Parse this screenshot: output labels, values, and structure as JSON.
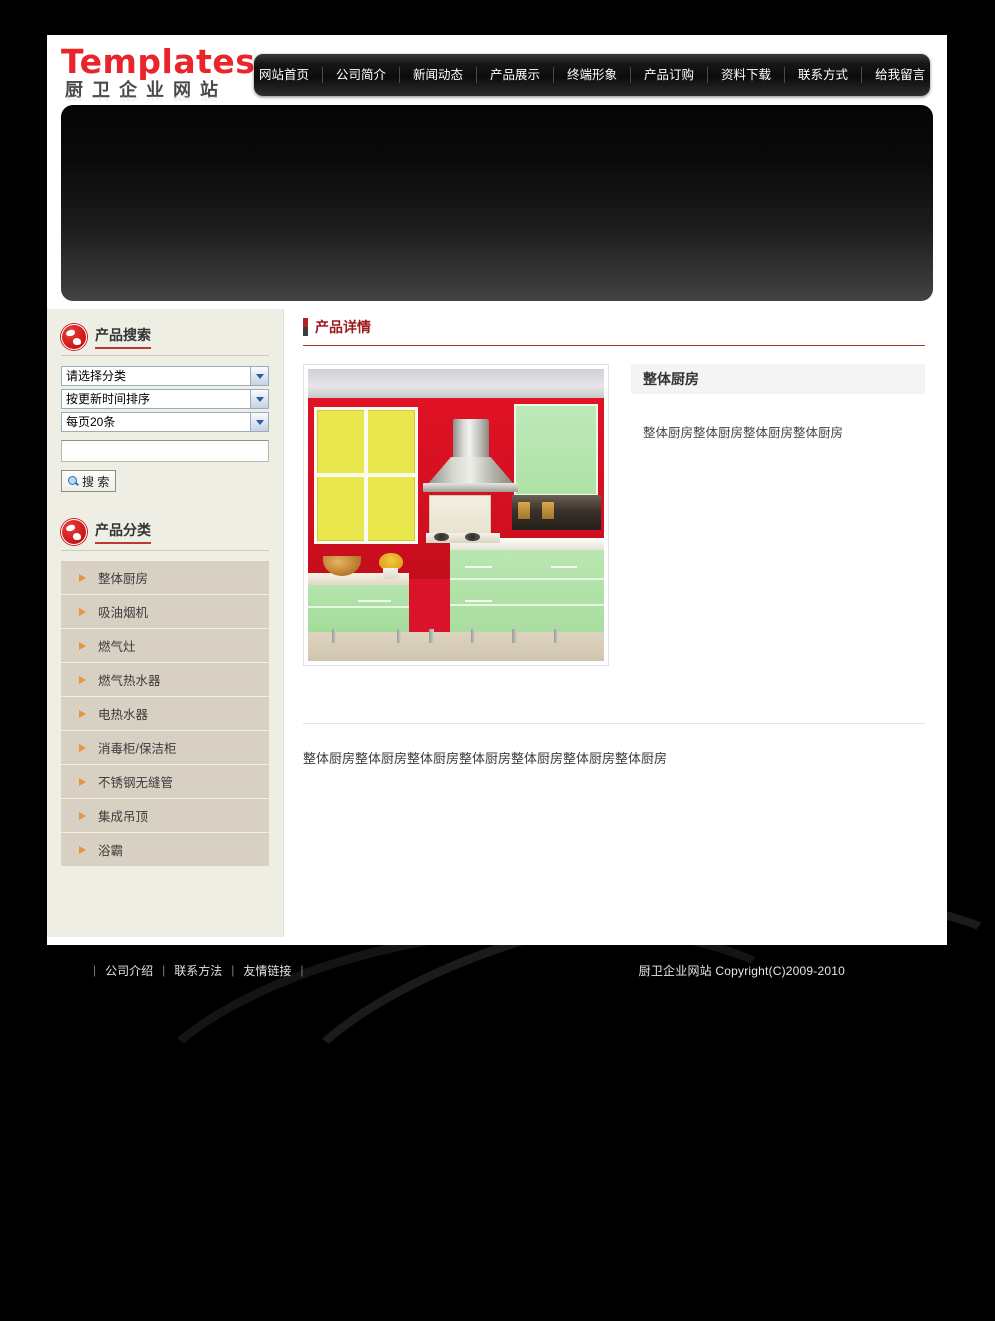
{
  "site": {
    "logo_main": "Templates",
    "logo_sub": "厨卫企业网站"
  },
  "nav": {
    "items": [
      {
        "label": "网站首页"
      },
      {
        "label": "公司简介"
      },
      {
        "label": "新闻动态"
      },
      {
        "label": "产品展示"
      },
      {
        "label": "终端形象"
      },
      {
        "label": "产品订购"
      },
      {
        "label": "资料下载"
      },
      {
        "label": "联系方式"
      },
      {
        "label": "给我留言"
      }
    ]
  },
  "sidebar": {
    "search_panel": {
      "title": "产品搜索",
      "category_select": "请选择分类",
      "sort_select": "按更新时间排序",
      "pagesize_select": "每页20条",
      "keyword_value": "",
      "keyword_placeholder": "",
      "search_button": "搜 索"
    },
    "category_panel": {
      "title": "产品分类",
      "items": [
        {
          "label": "整体厨房"
        },
        {
          "label": "吸油烟机"
        },
        {
          "label": "燃气灶"
        },
        {
          "label": "燃气热水器"
        },
        {
          "label": "电热水器"
        },
        {
          "label": "消毒柜/保洁柜"
        },
        {
          "label": "不锈钢无缝管"
        },
        {
          "label": "集成吊顶"
        },
        {
          "label": "浴霸"
        }
      ]
    }
  },
  "main": {
    "section_title": "产品详情",
    "product": {
      "name": "整体厨房",
      "summary": "整体厨房整体厨房整体厨房整体厨房",
      "detail": "整体厨房整体厨房整体厨房整体厨房整体厨房整体厨房整体厨房",
      "image_alt": "整体厨房产品图片"
    }
  },
  "footer": {
    "links": [
      {
        "label": "公司介绍"
      },
      {
        "label": "联系方法"
      },
      {
        "label": "友情链接"
      }
    ],
    "copyright": "厨卫企业网站  Copyright(C)2009-2010"
  },
  "colors": {
    "brand_red": "#e8252a",
    "section_red": "#9e1b20",
    "sidebar_bg": "#efeee4",
    "category_bg": "#d8d0c2",
    "bullet_orange": "#e8963c"
  }
}
